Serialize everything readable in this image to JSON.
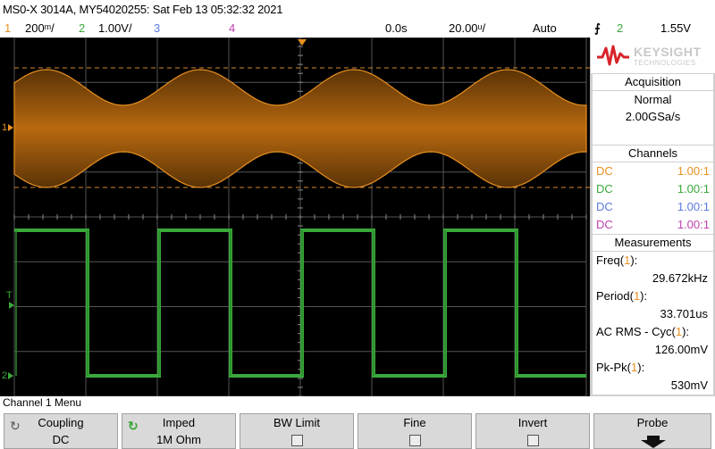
{
  "title": "MS0-X 3014A, MY54020255: Sat Feb 13 05:32:32 2021",
  "status": {
    "ch1_num": "1",
    "ch1_scale": "200ᵐ/",
    "ch2_num": "2",
    "ch2_scale": "1.00V/",
    "ch3_num": "3",
    "ch4_num": "4",
    "time_offset": "0.0s",
    "time_scale": "20.00ᵘ/",
    "trigger_mode": "Auto",
    "trigger_icon": "⨍",
    "trigger_source": "2",
    "trigger_level": "1.55V"
  },
  "colors": {
    "ch1": "#e89020",
    "ch2": "#3aa83a",
    "ch3": "#5a7ae0",
    "ch4": "#c040b0",
    "grid": "#5a5a5a"
  },
  "logo": {
    "name": "KEYSIGHT",
    "sub": "TECHNOLOGIES"
  },
  "acquisition": {
    "header": "Acquisition",
    "mode": "Normal",
    "rate": "2.00GSa/s"
  },
  "channels": {
    "header": "Channels",
    "rows": [
      {
        "coupling": "DC",
        "probe": "1.00:1"
      },
      {
        "coupling": "DC",
        "probe": "1.00:1"
      },
      {
        "coupling": "DC",
        "probe": "1.00:1"
      },
      {
        "coupling": "DC",
        "probe": "1.00:1"
      }
    ]
  },
  "measurements": {
    "header": "Measurements",
    "freq_label": "Freq",
    "freq_ch": "1",
    "freq_value": "29.672kHz",
    "period_label": "Period",
    "period_ch": "1",
    "period_value": "33.701us",
    "acrms_label": "AC RMS - Cyc",
    "acrms_ch": "1",
    "acrms_value": "126.00mV",
    "pkpk_label": "Pk-Pk",
    "pkpk_ch": "1",
    "pkpk_value": "530mV"
  },
  "scope_markers": {
    "ch1": "1",
    "trig": "T",
    "ch2": "2"
  },
  "menu": {
    "title": "Channel 1 Menu",
    "keys": [
      {
        "label": "Coupling",
        "value": "DC"
      },
      {
        "label": "Imped",
        "value": "1M Ohm"
      },
      {
        "label": "BW Limit"
      },
      {
        "label": "Fine"
      },
      {
        "label": "Invert"
      },
      {
        "label": "Probe"
      }
    ]
  }
}
